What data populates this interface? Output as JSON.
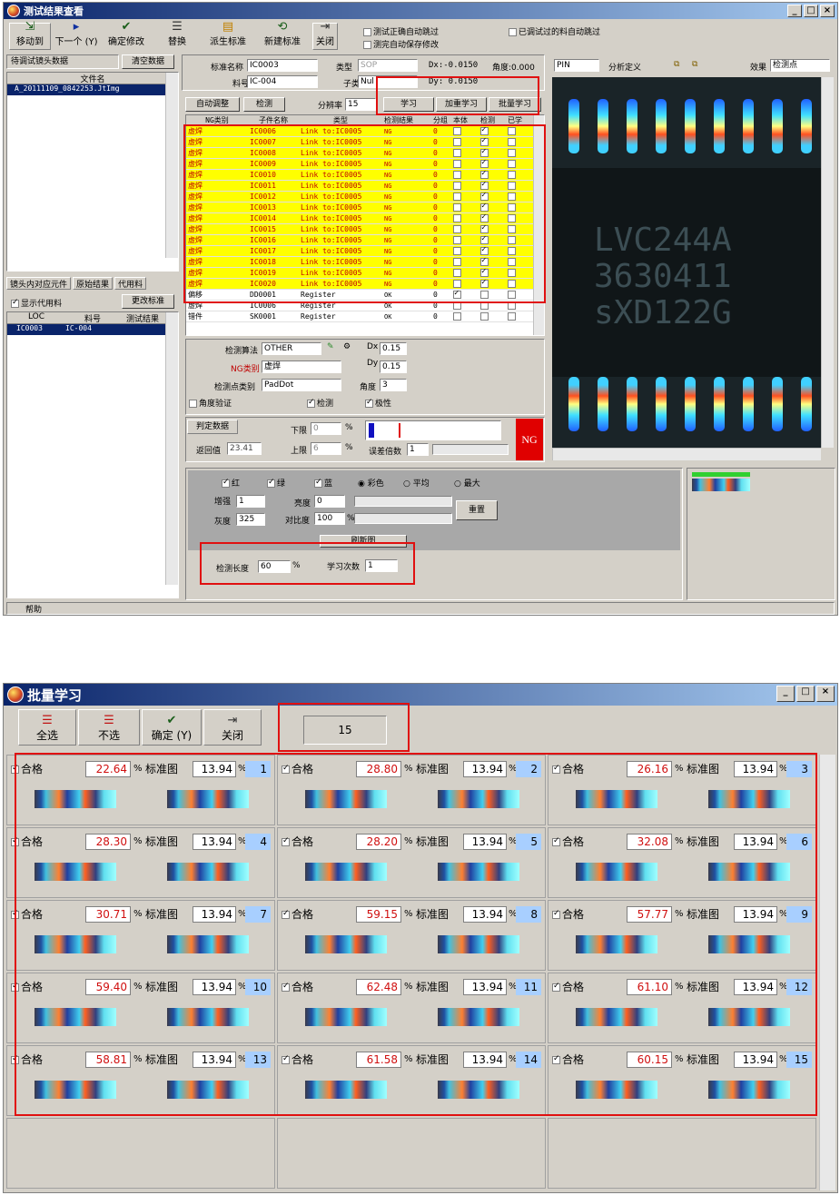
{
  "top": {
    "title": "测试结果查看",
    "toolbar": [
      "移动到",
      "下一个 (Y)",
      "确定修改",
      "替换",
      "派生标准",
      "新建标准",
      "关闭"
    ],
    "checks": [
      "测试正确自动跳过",
      "测完自动保存修改",
      "已调试过的料自动跳过"
    ],
    "left": {
      "to_test_label": "待调试镜头数据",
      "clear_btn": "清空数据",
      "file_col": "文件名",
      "file_row": "A_20111109_0842253.JtImg",
      "tabs": [
        "镜头内对应元件",
        "原始结果",
        "代用料"
      ],
      "show_sub": "显示代用料",
      "change_std": "更改标准",
      "cols": [
        "LOC",
        "料号",
        "测试结果"
      ],
      "row": [
        "IC0003",
        "IC-004"
      ],
      "help": "帮助"
    },
    "info": {
      "std_name_label": "标准名称",
      "std_name": "IC0003",
      "type_label": "类型",
      "type": "SOP",
      "dx_text": "Dx:-0.0150",
      "angle_text": "角度:0.000",
      "part_label": "料号",
      "part": "IC-004",
      "sub_label": "子类",
      "sub": "Nul",
      "dy_text": "Dy: 0.0150"
    },
    "btns": [
      "自动调整",
      "检测",
      "分辨率",
      "15",
      "学习",
      "加重学习",
      "批量学习"
    ],
    "grid_cols": [
      "NG类别",
      "子件名称",
      "类型",
      "检测结果",
      "分组",
      "本体",
      "检测",
      "已学"
    ],
    "grid_rows": [
      [
        "虚焊",
        "IC0006",
        "Link to:IC0005",
        "NG",
        "0"
      ],
      [
        "虚焊",
        "IC0007",
        "Link to:IC0005",
        "NG",
        "0"
      ],
      [
        "虚焊",
        "IC0008",
        "Link to:IC0005",
        "NG",
        "0"
      ],
      [
        "虚焊",
        "IC0009",
        "Link to:IC0005",
        "NG",
        "0"
      ],
      [
        "虚焊",
        "IC0010",
        "Link to:IC0005",
        "NG",
        "0"
      ],
      [
        "虚焊",
        "IC0011",
        "Link to:IC0005",
        "NG",
        "0"
      ],
      [
        "虚焊",
        "IC0012",
        "Link to:IC0005",
        "NG",
        "0"
      ],
      [
        "虚焊",
        "IC0013",
        "Link to:IC0005",
        "NG",
        "0"
      ],
      [
        "虚焊",
        "IC0014",
        "Link to:IC0005",
        "NG",
        "0"
      ],
      [
        "虚焊",
        "IC0015",
        "Link to:IC0005",
        "NG",
        "0"
      ],
      [
        "虚焊",
        "IC0016",
        "Link to:IC0005",
        "NG",
        "0"
      ],
      [
        "虚焊",
        "IC0017",
        "Link to:IC0005",
        "NG",
        "0"
      ],
      [
        "虚焊",
        "IC0018",
        "Link to:IC0005",
        "NG",
        "0"
      ],
      [
        "虚焊",
        "IC0019",
        "Link to:IC0005",
        "NG",
        "0"
      ],
      [
        "虚焊",
        "IC0020",
        "Link to:IC0005",
        "NG",
        "0"
      ],
      [
        "偏移",
        "DD0001",
        "Register",
        "OK",
        "0"
      ],
      [
        "虚焊",
        "IC0006",
        "Register",
        "OK",
        "0"
      ],
      [
        "错件",
        "SK0001",
        "Register",
        "OK",
        "0"
      ]
    ],
    "algo": {
      "algo_label": "检测算法",
      "algo": "OTHER",
      "ng_label": "NG类别",
      "ng": "虚焊",
      "pt_label": "检测点类别",
      "pt": "PadDot",
      "dx_label": "Dx",
      "dx": "0.15",
      "dy_label": "Dy",
      "dy": "0.15",
      "ang_label": "角度",
      "ang": "3",
      "ang_check": "角度验证",
      "detect": "检测",
      "polar": "极性"
    },
    "judge": {
      "title": "判定数据",
      "low_label": "下限",
      "low": "0",
      "pct": "%",
      "ret_label": "返回值",
      "ret": "23.41",
      "up_label": "上限",
      "up": "6",
      "mult_label": "误差倍数",
      "mult": "1",
      "result": "NG"
    },
    "right": {
      "pin": "PIN",
      "analysis": "分析定义",
      "effect_label": "效果",
      "effect": "检测点",
      "chip": [
        "LVC244A",
        "3630411",
        "sXD122G"
      ]
    },
    "color": {
      "r": "红",
      "g": "绿",
      "b": "蓝",
      "color": "彩色",
      "avg": "平均",
      "max": "最大",
      "gain_label": "增强",
      "gain": "1",
      "bright_label": "亮度",
      "bright": "0",
      "gray_label": "灰度",
      "gray": "325",
      "contrast_label": "对比度",
      "contrast": "100",
      "reset": "重置",
      "refresh": "刷新图",
      "len_label": "检测长度",
      "len": "60",
      "pct": "%",
      "learn_label": "学习次数",
      "learn": "1"
    }
  },
  "bottom": {
    "title": "批量学习",
    "toolbar": [
      "全选",
      "不选",
      "确定 (Y)",
      "关闭"
    ],
    "count": "15",
    "ok_label": "合格",
    "std_label": "标准图",
    "std_val": "13.94",
    "pct": "%",
    "items": [
      {
        "v": "22.64",
        "n": "1"
      },
      {
        "v": "28.80",
        "n": "2"
      },
      {
        "v": "26.16",
        "n": "3"
      },
      {
        "v": "28.30",
        "n": "4"
      },
      {
        "v": "28.20",
        "n": "5"
      },
      {
        "v": "32.08",
        "n": "6"
      },
      {
        "v": "30.71",
        "n": "7"
      },
      {
        "v": "59.15",
        "n": "8"
      },
      {
        "v": "57.77",
        "n": "9"
      },
      {
        "v": "59.40",
        "n": "10"
      },
      {
        "v": "62.48",
        "n": "11"
      },
      {
        "v": "61.10",
        "n": "12"
      },
      {
        "v": "58.81",
        "n": "13"
      },
      {
        "v": "61.58",
        "n": "14"
      },
      {
        "v": "60.15",
        "n": "15"
      }
    ]
  },
  "colors": {
    "highlight": "#e01010",
    "ng_row": "#ffff00",
    "title_start": "#0a246a",
    "ng_block": "#e00000"
  }
}
